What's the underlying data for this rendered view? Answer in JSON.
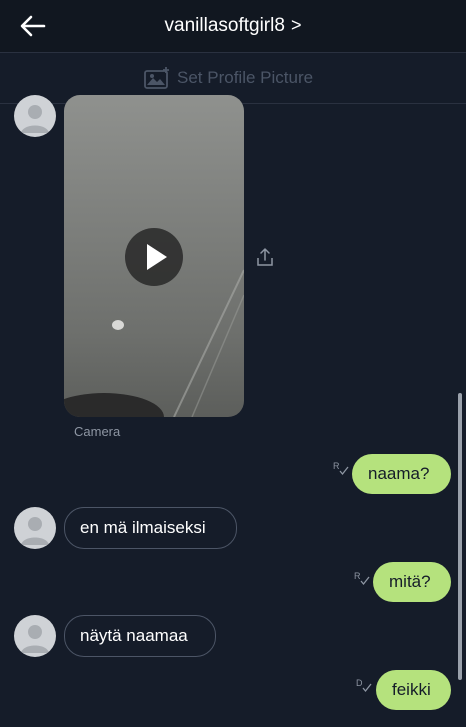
{
  "header": {
    "title": "vanillasoftgirl8",
    "title_chevron": ">",
    "back_icon": "arrow-left-icon"
  },
  "profile_bar": {
    "label": "Set Profile Picture",
    "icon": "add-image-icon"
  },
  "video_message": {
    "caption": "Camera",
    "icon": "play-icon",
    "share_icon": "share-icon"
  },
  "messages": [
    {
      "direction": "out",
      "text": "naama?",
      "status": "R"
    },
    {
      "direction": "in",
      "text": "en mä ilmaiseksi"
    },
    {
      "direction": "out",
      "text": "mitä?",
      "status": "R"
    },
    {
      "direction": "in",
      "text": "näytä naamaa"
    },
    {
      "direction": "out",
      "text": "feikki",
      "status": "D"
    }
  ],
  "colors": {
    "background": "#151c29",
    "outgoing_bubble": "#b5e27d",
    "incoming_border": "#4c5566",
    "muted_text": "#4b5566"
  }
}
